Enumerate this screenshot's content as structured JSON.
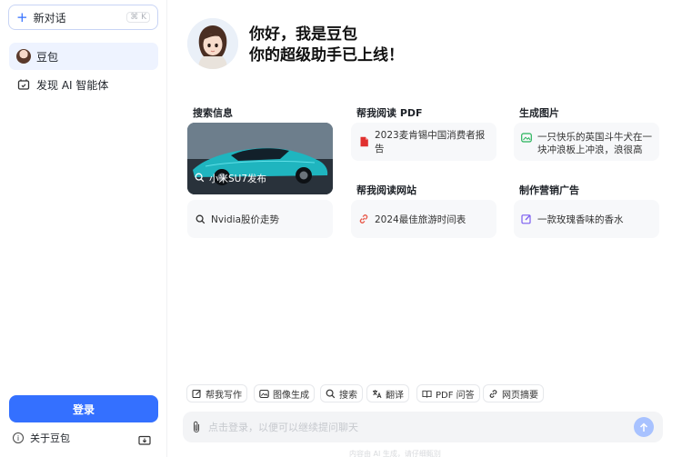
{
  "sidebar": {
    "new_chat": {
      "label": "新对话",
      "shortcut": "⌘ K"
    },
    "items": [
      {
        "label": "豆包",
        "icon": "doubao-avatar-icon",
        "active": true
      },
      {
        "label": "发现 AI 智能体",
        "icon": "discover-agent-icon",
        "active": false
      }
    ],
    "login_label": "登录",
    "about_label": "关于豆包"
  },
  "hero": {
    "line1": "你好，我是豆包",
    "line2": "你的超级助手已上线！"
  },
  "sections": {
    "search": {
      "label": "搜索信息",
      "image_card_caption": "小米SU7发布",
      "card": "Nvidia股价走势"
    },
    "read_pdf": {
      "label": "帮我阅读 PDF",
      "card": "2023麦肯锡中国消费者报告"
    },
    "read_web": {
      "label": "帮我阅读网站",
      "card": "2024最佳旅游时间表"
    },
    "gen_image": {
      "label": "生成图片",
      "card_line1": "一只快乐的英国斗牛犬在一",
      "card_line2": "块冲浪板上冲浪，浪很高"
    },
    "marketing": {
      "label": "制作营销广告",
      "card": "一款玫瑰香味的香水"
    }
  },
  "toolbar": [
    {
      "label": "帮我写作",
      "icon": "edit-icon"
    },
    {
      "label": "图像生成",
      "icon": "image-icon"
    },
    {
      "label": "搜索",
      "icon": "search-icon"
    },
    {
      "label": "翻译",
      "icon": "translate-icon"
    },
    {
      "label": "PDF 问答",
      "icon": "book-icon"
    },
    {
      "label": "网页摘要",
      "icon": "link-icon"
    }
  ],
  "input": {
    "placeholder": "点击登录，以便可以继续提问聊天",
    "footnote": "内容由 AI 生成，请仔细甄别"
  },
  "colors": {
    "accent": "#3470ff",
    "send_disabled": "#a8c2ff",
    "card_bg": "#f7f8fa",
    "pdf_red": "#e0302f",
    "image_green": "#27b35a",
    "link_red": "#e8594a",
    "edit_purple": "#7b5cf0"
  }
}
